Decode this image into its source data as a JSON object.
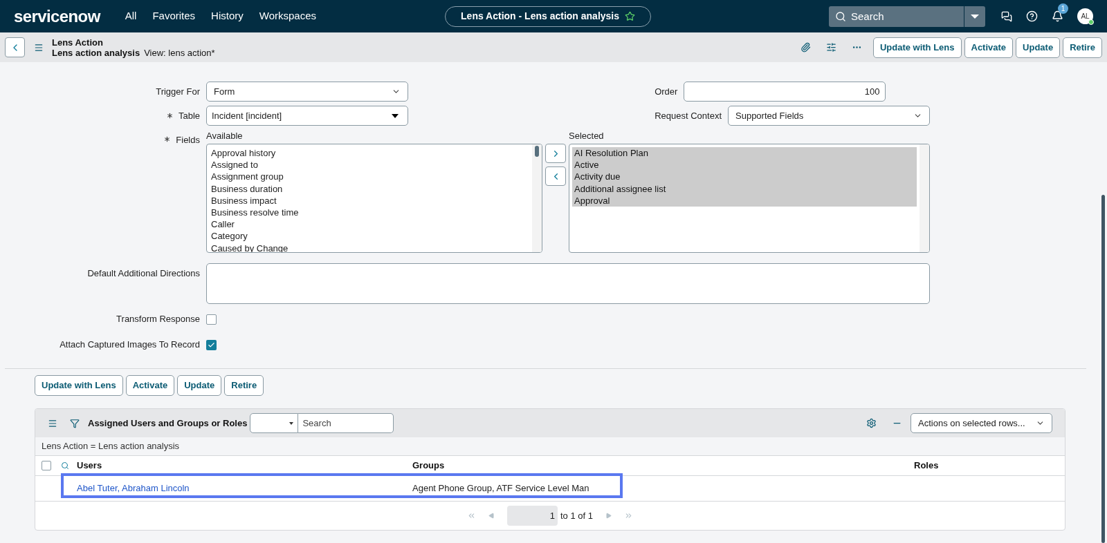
{
  "topbar": {
    "logo": "servicenow",
    "nav": [
      "All",
      "Favorites",
      "History",
      "Workspaces"
    ],
    "record_title": "Lens Action - Lens action analysis",
    "search": {
      "placeholder": "Search"
    },
    "notifications": "1",
    "avatar": "AL"
  },
  "header": {
    "table": "Lens Action",
    "record": "Lens action analysis",
    "view": "View: lens action*",
    "buttons": [
      "Update with Lens",
      "Activate",
      "Update",
      "Retire"
    ]
  },
  "form": {
    "trigger_for": {
      "label": "Trigger For",
      "value": "Form"
    },
    "table": {
      "label": "Table",
      "required": true,
      "value": "Incident [incident]"
    },
    "order": {
      "label": "Order",
      "value": "100"
    },
    "request_context": {
      "label": "Request Context",
      "value": "Supported Fields"
    },
    "fields": {
      "label": "Fields",
      "required": true,
      "available_label": "Available",
      "selected_label": "Selected",
      "available": [
        {
          "label": "Approval history",
          "selected": false
        },
        {
          "label": "Assigned to",
          "selected": false
        },
        {
          "label": "Assignment group",
          "selected": false
        },
        {
          "label": "Business duration",
          "selected": false
        },
        {
          "label": "Business impact",
          "selected": false
        },
        {
          "label": "Business resolve time",
          "selected": false
        },
        {
          "label": "Caller",
          "selected": false
        },
        {
          "label": "Category",
          "selected": false
        },
        {
          "label": "Caused by Change",
          "selected": false
        }
      ],
      "chosen": [
        {
          "label": "AI Resolution Plan",
          "selected": true
        },
        {
          "label": "Active",
          "selected": true
        },
        {
          "label": "Activity due",
          "selected": true
        },
        {
          "label": "Additional assignee list",
          "selected": true
        },
        {
          "label": "Approval",
          "selected": true
        }
      ]
    },
    "directions": {
      "label": "Default Additional Directions"
    },
    "transform_response": {
      "label": "Transform Response",
      "checked": false
    },
    "attach_images": {
      "label": "Attach Captured Images To Record",
      "checked": true
    }
  },
  "bottom_buttons": [
    "Update with Lens",
    "Activate",
    "Update",
    "Retire"
  ],
  "related_list": {
    "title": "Assigned Users and Groups or Roles",
    "search": {
      "placeholder": "Search"
    },
    "actions": "Actions on selected rows...",
    "breadcrumb": "Lens Action = Lens action analysis",
    "select_all": {
      "checked": false
    },
    "columns": [
      "Users",
      "Groups",
      "Roles"
    ],
    "rows": [
      {
        "users": "Abel Tuter, Abraham Lincoln",
        "groups": "Agent Phone Group, ATF Service Level Man",
        "highlighted": true
      }
    ],
    "pagination": {
      "page": "1",
      "range": "to 1 of 1"
    }
  }
}
